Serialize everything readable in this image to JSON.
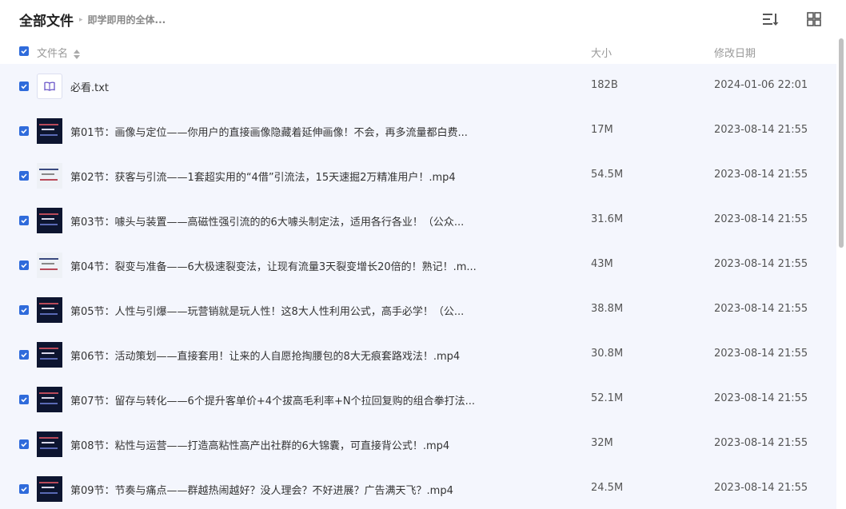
{
  "breadcrumb": {
    "root": "全部文件",
    "current": "即学即用的全体..."
  },
  "toolbar": {
    "sort_icon": "sort-lines-icon",
    "view_icon": "grid-view-icon"
  },
  "columns": {
    "name": "文件名",
    "size": "大小",
    "date": "修改日期"
  },
  "colors": {
    "accent": "#2f6bdb",
    "selected_row": "#f4f6fd"
  },
  "files": [
    {
      "name": "必看.txt",
      "size": "182B",
      "date": "2024-01-06 22:01",
      "type": "txt",
      "checked": true
    },
    {
      "name": "第01节：画像与定位——你用户的直接画像隐藏着延伸画像！不会，再多流量都白费...",
      "size": "17M",
      "date": "2023-08-14 21:55",
      "type": "video",
      "checked": true
    },
    {
      "name": "第02节：获客与引流——1套超实用的“4借”引流法，15天速掘2万精准用户！.mp4",
      "size": "54.5M",
      "date": "2023-08-14 21:55",
      "type": "video",
      "checked": true
    },
    {
      "name": "第03节：噱头与装置——高磁性强引流的的6大噱头制定法，适用各行各业！（公众...",
      "size": "31.6M",
      "date": "2023-08-14 21:55",
      "type": "video",
      "checked": true
    },
    {
      "name": "第04节：裂变与准备——6大极速裂变法，让现有流量3天裂变增长20倍的！熟记！.m...",
      "size": "43M",
      "date": "2023-08-14 21:55",
      "type": "video",
      "checked": true
    },
    {
      "name": "第05节：人性与引爆——玩营销就是玩人性！这8大人性利用公式，高手必学！（公...",
      "size": "38.8M",
      "date": "2023-08-14 21:55",
      "type": "video",
      "checked": true
    },
    {
      "name": "第06节：活动策划——直接套用！让来的人自愿抢掏腰包的8大无痕套路戏法！.mp4",
      "size": "30.8M",
      "date": "2023-08-14 21:55",
      "type": "video",
      "checked": true
    },
    {
      "name": "第07节：留存与转化——6个提升客单价+4个拔高毛利率+N个拉回复购的组合拳打法...",
      "size": "52.1M",
      "date": "2023-08-14 21:55",
      "type": "video",
      "checked": true
    },
    {
      "name": "第08节：粘性与运营——打造高粘性高产出社群的6大锦囊，可直接背公式！.mp4",
      "size": "32M",
      "date": "2023-08-14 21:55",
      "type": "video",
      "checked": true
    },
    {
      "name": "第09节：节奏与痛点——群越热闹越好？没人理会？不好进展？广告满天飞？.mp4",
      "size": "24.5M",
      "date": "2023-08-14 21:55",
      "type": "video",
      "checked": true
    }
  ]
}
